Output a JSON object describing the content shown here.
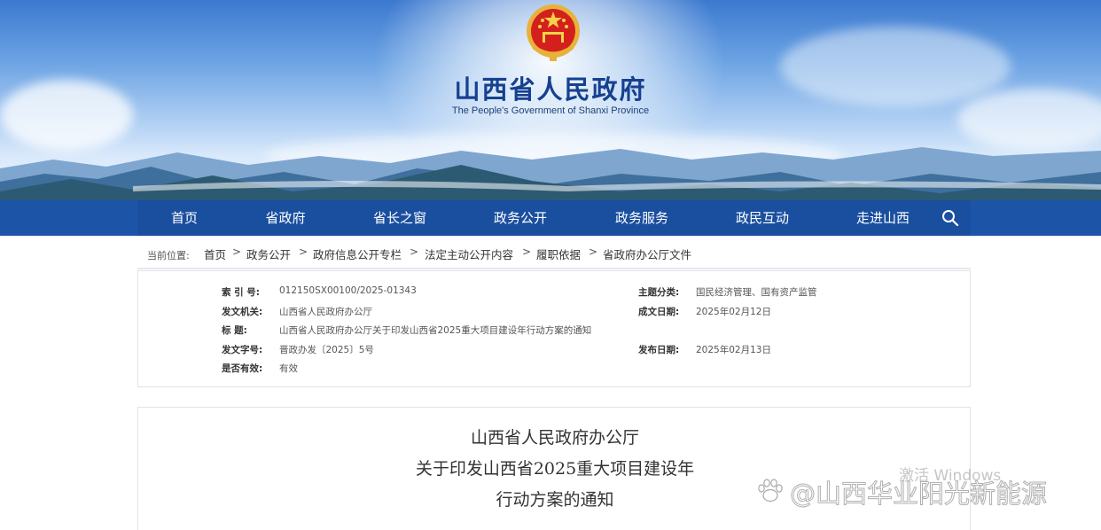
{
  "header": {
    "title": "山西省人民政府",
    "subtitle": "The People's Government of Shanxi Province",
    "emblem_icon": "national-emblem"
  },
  "nav": {
    "items": [
      "首页",
      "省政府",
      "省长之窗",
      "政务公开",
      "政务服务",
      "政民互动",
      "走进山西"
    ],
    "search_icon": "search-icon"
  },
  "breadcrumb": {
    "prefix": "当前位置:",
    "items": [
      "首页",
      "政务公开",
      "政府信息公开专栏",
      "法定主动公开内容",
      "履职依据",
      "省政府办公厅文件"
    ],
    "separator": ">"
  },
  "meta": {
    "index_label": "索  引  号:",
    "index_value": "012150SX00100/2025-01343",
    "topic_label": "主题分类:",
    "topic_value": "国民经济管理、国有资产监管",
    "issuer_label": "发文机关:",
    "issuer_value": "山西省人民政府办公厅",
    "date_label": "成文日期:",
    "date_value": "2025年02月12日",
    "title_label": "标      题:",
    "title_value": "山西省人民政府办公厅关于印发山西省2025重大项目建设年行动方案的通知",
    "docno_label": "发文字号:",
    "docno_value": "晋政办发〔2025〕5号",
    "pubdate_label": "发布日期:",
    "pubdate_value": "2025年02月13日",
    "valid_label": "是否有效:",
    "valid_value": "有效"
  },
  "document": {
    "line1": "山西省人民政府办公厅",
    "line2": "关于印发山西省2025重大项目建设年",
    "line3": "行动方案的通知"
  },
  "overlay": {
    "activate_windows": "激活 Windows",
    "watermark": "@山西华业阳光新能源"
  },
  "colors": {
    "nav_bg": "#1c55a8",
    "title_blue": "#15418f"
  }
}
